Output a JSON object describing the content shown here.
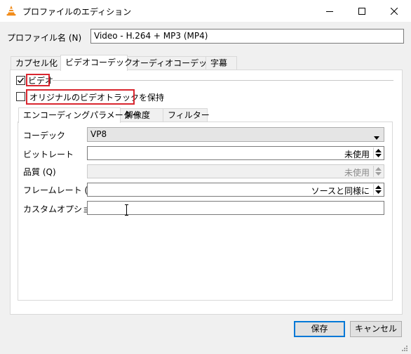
{
  "window": {
    "title": "プロファイルのエディション",
    "icon": "vlc-cone-icon",
    "controls": [
      "minimize",
      "maximize",
      "close"
    ]
  },
  "profile": {
    "label": "プロファイル名 (N)",
    "value": "Video - H.264 + MP3 (MP4)"
  },
  "tabs": [
    {
      "label": "カプセル化",
      "active": false
    },
    {
      "label": "ビデオコーデック",
      "active": true
    },
    {
      "label": "オーディオコーデック",
      "active": false
    },
    {
      "label": "字幕",
      "active": false
    }
  ],
  "video": {
    "enable_label": "ビデオ",
    "enable_checked": true,
    "keep_original_label": "オリジナルのビデオトラックを保持",
    "keep_original_checked": false
  },
  "inner_tabs": [
    {
      "label": "エンコーディングパラメーター",
      "active": true
    },
    {
      "label": "解像度",
      "active": false
    },
    {
      "label": "フィルター",
      "active": false
    }
  ],
  "form": {
    "codec_label": "コーデック",
    "codec_value": "VP8",
    "bitrate_label": "ビットレート",
    "bitrate_value": "未使用",
    "quality_label": "品質 (Q)",
    "quality_value": "未使用",
    "fps_label": "フレームレート (m)",
    "fps_value": "ソースと同様に",
    "custom_label": "カスタムオプション",
    "custom_value": ""
  },
  "buttons": {
    "save": "保存",
    "cancel": "キャンセル"
  },
  "colors": {
    "highlight": "#d9262f",
    "focus": "#0078d7",
    "window_bg": "#f0f0f0"
  }
}
